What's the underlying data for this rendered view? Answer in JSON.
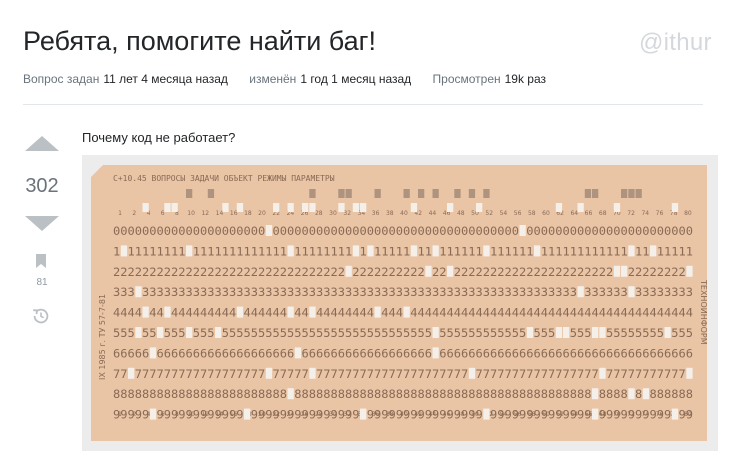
{
  "question": {
    "title": "Ребята, помогите найти баг!",
    "watermark": "@ithur",
    "meta": {
      "asked_label": "Вопрос задан",
      "asked_value": "11 лет 4 месяца назад",
      "modified_label": "изменён",
      "modified_value": "1 год 1 месяц назад",
      "viewed_label": "Просмотрен",
      "viewed_value": "19k раз"
    },
    "votes": "302",
    "bookmarks": "81",
    "body_text": "Почему код не работает?"
  },
  "punch_card": {
    "alt": "Перфокарта",
    "header_text": "С+10.45 ВОПРОСЫ ЗАДАЧИ ОБЪЕКТ РЕЖИМЫ ПАРАМЕТРЫ",
    "digit_rows": [
      "0",
      "1",
      "2",
      "3",
      "4",
      "5",
      "6",
      "7",
      "8",
      "9"
    ],
    "column_numbers": [
      "1",
      "2",
      "4",
      "6",
      "8",
      "10",
      "12",
      "14",
      "16",
      "18",
      "20",
      "22",
      "24",
      "26",
      "28",
      "30",
      "32",
      "34",
      "36",
      "38",
      "40",
      "42",
      "44",
      "46",
      "48",
      "50",
      "52",
      "54",
      "56",
      "58",
      "60",
      "62",
      "64",
      "66",
      "68",
      "70",
      "72",
      "74",
      "76",
      "78",
      "80"
    ],
    "left_imprint": "IX 1985 г. ТУ 57-7-81",
    "right_imprint": "ТЕХНОИНФОРМ",
    "colors": {
      "card": "#e9c5a6",
      "ink": "#8a6a55",
      "hole": "#f4efe9",
      "background": "#ececec"
    }
  }
}
